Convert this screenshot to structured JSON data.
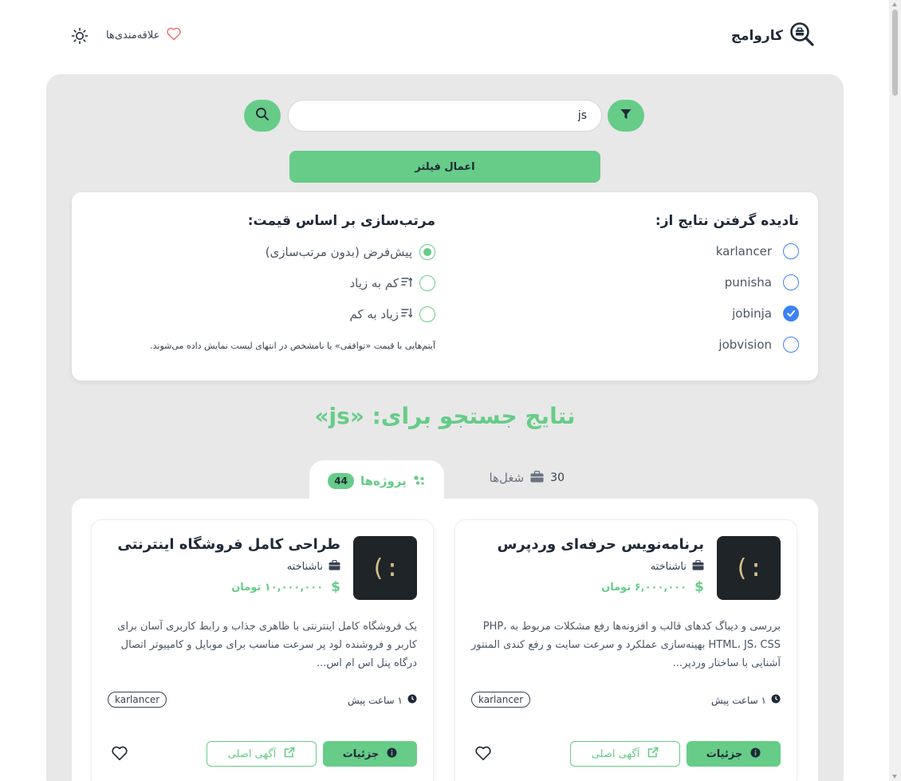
{
  "header": {
    "brand": "کاروامج",
    "favorites_label": "علاقه‌مندی‌ها"
  },
  "search": {
    "query": "js",
    "placeholder": "",
    "apply_filter_label": "اعمال فیلتر"
  },
  "filters": {
    "ignore_title": "نادیده گرفتن نتایج از:",
    "sources": [
      {
        "label": "karlancer",
        "checked": false
      },
      {
        "label": "punisha",
        "checked": false
      },
      {
        "label": "jobinja",
        "checked": true
      },
      {
        "label": "jobvision",
        "checked": false
      }
    ],
    "sort_title": "مرتب‌سازی بر اساس قیمت:",
    "sort_options": [
      {
        "label": "پیش‌فرض (بدون مرتب‌سازی)",
        "selected": true
      },
      {
        "label": "کم به زیاد",
        "selected": false
      },
      {
        "label": "زیاد به کم",
        "selected": false
      }
    ],
    "note": "آیتم‌هایی با قیمت «توافقی» یا نامشخص در انتهای لیست نمایش داده می‌شوند."
  },
  "results": {
    "title": "نتایج جستجو برای: «js»",
    "tabs": [
      {
        "label": "پروژه‌ها",
        "count": "44",
        "active": true
      },
      {
        "label": "شغل‌ها",
        "count": "30",
        "active": false
      }
    ],
    "cards": [
      {
        "logo_text": ":)",
        "title": "برنامه‌نویس حرفه‌ای وردپرس",
        "company": "ناشناخته",
        "price": "۶,۰۰۰,۰۰۰ تومان",
        "description": "بررسی و دیباگ کدهای قالب و افزونه‌ها رفع مشکلات مربوط به PHP، HTML، JS، CSS بهینه‌سازی عملکرد و سرعت سایت و رفع کندی المنتور آشنایی با ساختار وردپر...",
        "time": "۱ ساعت پیش",
        "source": "karlancer",
        "details_label": "جزئیات",
        "original_label": "آگهی اصلی"
      },
      {
        "logo_text": ":)",
        "title": "طراحی کامل فروشگاه اینترنتی",
        "company": "ناشناخته",
        "price": "۱۰,۰۰۰,۰۰۰ تومان",
        "description": "یک فروشگاه کامل اینترنتی با ظاهری جذاب و رابط کاربری آسان برای کاربر و فروشنده لود پر سرعت مناسب برای موبایل و کامپیوتر اتصال درگاه پنل اس ام اس...",
        "time": "۱ ساعت پیش",
        "source": "karlancer",
        "details_label": "جزئیات",
        "original_label": "آگهی اصلی"
      }
    ]
  },
  "colors": {
    "accent": "#66cc88",
    "checkbox_blue": "#3b82f6",
    "panel_bg": "#e8e8e8",
    "text_dark": "#1f2937"
  },
  "icons": {
    "brand": "search-briefcase-icon",
    "favorites": "heart-icon",
    "theme": "sun-icon",
    "search": "search-icon",
    "filter": "funnel-icon",
    "projects_tab": "puzzle-icon",
    "jobs_tab": "briefcase-icon",
    "company": "briefcase-icon",
    "price": "dollar-icon",
    "time": "clock-icon",
    "details": "info-icon",
    "original": "external-link-icon",
    "favorite_card": "heart-outline-icon"
  }
}
